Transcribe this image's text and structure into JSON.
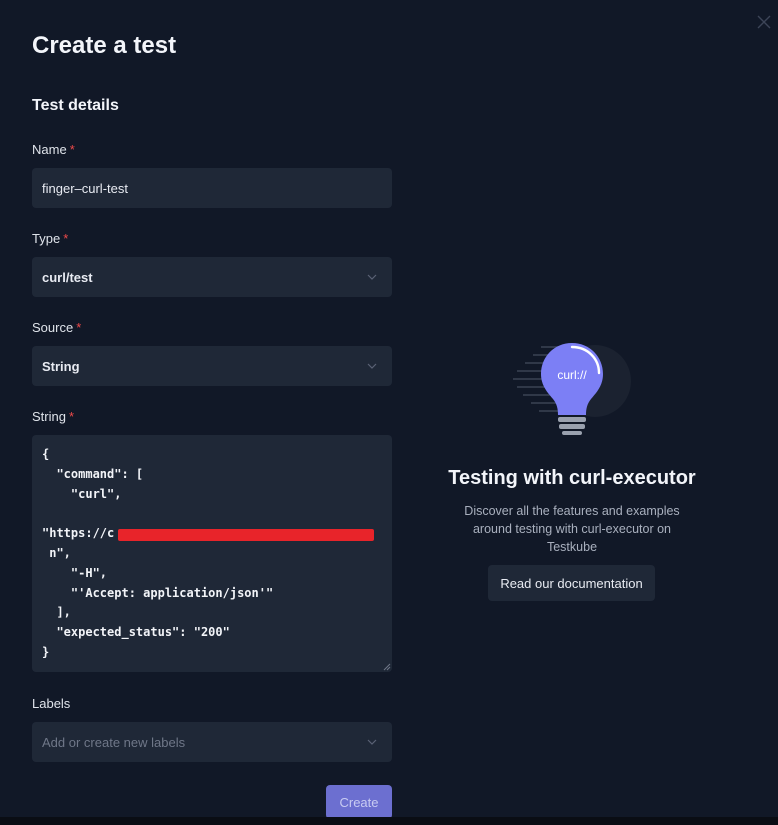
{
  "modal": {
    "title": "Create a test",
    "section_title": "Test details"
  },
  "form": {
    "name": {
      "label": "Name",
      "required_mark": "*",
      "value": "finger–curl-test"
    },
    "type": {
      "label": "Type",
      "required_mark": "*",
      "value": "curl/test"
    },
    "source": {
      "label": "Source",
      "required_mark": "*",
      "value": "String"
    },
    "string": {
      "label": "String",
      "required_mark": "*",
      "value": "{\n  \"command\": [\n    \"curl\",\n\n\"https://c\n n\",\n    \"-H\",\n    \"'Accept: application/json'\"\n  ],\n  \"expected_status\": \"200\"\n}"
    },
    "labels": {
      "label": "Labels",
      "placeholder": "Add or create new labels"
    },
    "create_label": "Create"
  },
  "promo": {
    "icon_text": "curl://",
    "title": "Testing with curl-executor",
    "description": "Discover all the features and examples around testing with curl-executor on Testkube",
    "button_label": "Read our documentation"
  },
  "colors": {
    "background": "#111827",
    "field": "#1f2837",
    "accent": "#6c6fd0",
    "required": "#ef4a4a",
    "bulb": "#7c7ff5"
  }
}
